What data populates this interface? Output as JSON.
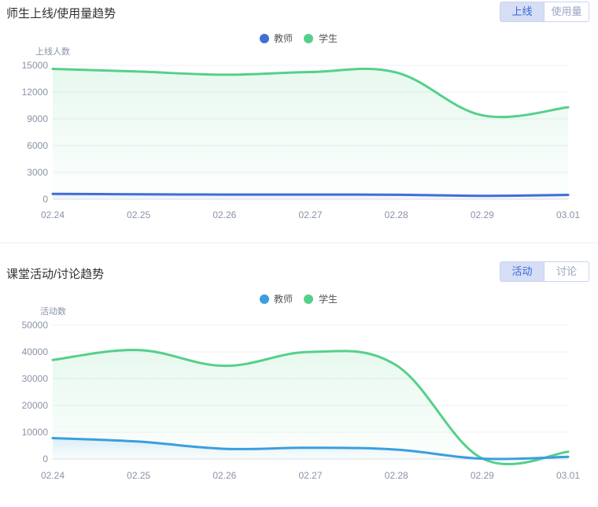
{
  "panel1": {
    "title": "师生上线/使用量趋势",
    "toggle": [
      "上线",
      "使用量"
    ],
    "active_index": 0
  },
  "panel2": {
    "title": "课堂活动/讨论趋势",
    "toggle": [
      "活动",
      "讨论"
    ],
    "active_index": 0
  },
  "colors": {
    "teacher1": "#3f6fd6",
    "teacher2": "#3a9ee0",
    "student": "#55d08a",
    "accent": "#3a67d8"
  },
  "chart_data": [
    {
      "type": "area",
      "ylabel": "上线人数",
      "x": [
        "02.24",
        "02.25",
        "02.26",
        "02.27",
        "02.28",
        "02.29",
        "03.01"
      ],
      "ylim": [
        0,
        15000
      ],
      "yticks": [
        0,
        3000,
        6000,
        9000,
        12000,
        15000
      ],
      "legend_position": "top-center",
      "grid": true,
      "series": [
        {
          "name": "教师",
          "values": [
            600,
            550,
            520,
            520,
            500,
            380,
            480
          ]
        },
        {
          "name": "学生",
          "values": [
            14600,
            14300,
            13950,
            14250,
            14200,
            9400,
            10300
          ]
        }
      ]
    },
    {
      "type": "area",
      "ylabel": "活动数",
      "x": [
        "02.24",
        "02.25",
        "02.26",
        "02.27",
        "02.28",
        "02.29",
        "03.01"
      ],
      "ylim": [
        0,
        50000
      ],
      "yticks": [
        0,
        10000,
        20000,
        30000,
        40000,
        50000
      ],
      "legend_position": "top-center",
      "grid": true,
      "series": [
        {
          "name": "教师",
          "values": [
            7800,
            6500,
            3800,
            4200,
            3500,
            100,
            800
          ]
        },
        {
          "name": "学生",
          "values": [
            37000,
            40700,
            34800,
            40000,
            35000,
            200,
            2700
          ]
        }
      ]
    }
  ]
}
